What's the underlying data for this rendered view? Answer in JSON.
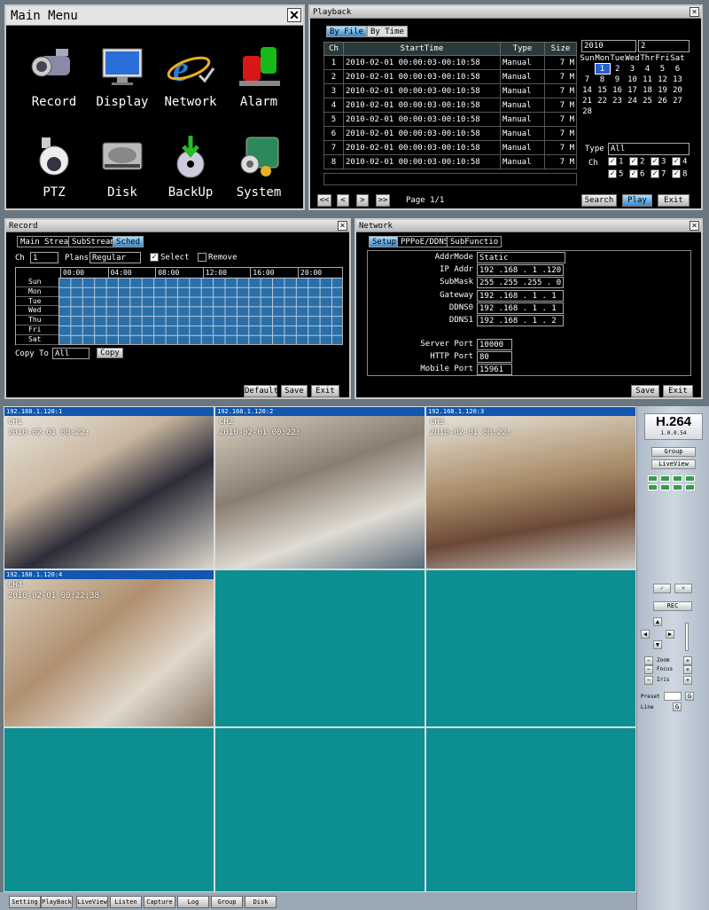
{
  "main_menu": {
    "title": "Main Menu",
    "items": [
      {
        "label": "Record",
        "icon": "camcorder-icon"
      },
      {
        "label": "Display",
        "icon": "monitor-icon"
      },
      {
        "label": "Network",
        "icon": "internet-explorer-icon"
      },
      {
        "label": "Alarm",
        "icon": "alarm-siren-icon"
      },
      {
        "label": "PTZ",
        "icon": "ptz-camera-icon"
      },
      {
        "label": "Disk",
        "icon": "hard-disk-icon"
      },
      {
        "label": "BackUp",
        "icon": "backup-disc-icon"
      },
      {
        "label": "System",
        "icon": "system-gear-icon"
      }
    ]
  },
  "playback": {
    "title": "Playback",
    "tabs": [
      "By File",
      "By Time"
    ],
    "columns": [
      "Ch",
      "StartTime",
      "Type",
      "Size"
    ],
    "rows": [
      {
        "ch": "1",
        "time": "2010-02-01 00:00:03-00:10:58",
        "type": "Manual",
        "size": "7 M"
      },
      {
        "ch": "2",
        "time": "2010-02-01 00:00:03-00:10:58",
        "type": "Manual",
        "size": "7 M"
      },
      {
        "ch": "3",
        "time": "2010-02-01 00:00:03-00:10:58",
        "type": "Manual",
        "size": "7 M"
      },
      {
        "ch": "4",
        "time": "2010-02-01 00:00:03-00:10:58",
        "type": "Manual",
        "size": "7 M"
      },
      {
        "ch": "5",
        "time": "2010-02-01 00:00:03-00:10:58",
        "type": "Manual",
        "size": "7 M"
      },
      {
        "ch": "6",
        "time": "2010-02-01 00:00:03-00:10:58",
        "type": "Manual",
        "size": "7 M"
      },
      {
        "ch": "7",
        "time": "2010-02-01 00:00:03-00:10:58",
        "type": "Manual",
        "size": "7 M"
      },
      {
        "ch": "8",
        "time": "2010-02-01 00:00:03-00:10:58",
        "type": "Manual",
        "size": "7 M"
      }
    ],
    "year": "2010",
    "month": "2",
    "weekdays": [
      "Sun",
      "Mon",
      "Tue",
      "Wed",
      "Thr",
      "Fri",
      "Sat"
    ],
    "days": [
      [
        "1",
        "2",
        "3",
        "4",
        "5",
        "6"
      ],
      [
        "7",
        "8",
        "9",
        "10",
        "11",
        "12",
        "13"
      ],
      [
        "14",
        "15",
        "16",
        "17",
        "18",
        "19",
        "20"
      ],
      [
        "21",
        "22",
        "23",
        "24",
        "25",
        "26",
        "27"
      ],
      [
        "28"
      ]
    ],
    "type_label": "Type",
    "type_value": "All",
    "ch_label": "Ch",
    "channels": [
      "1",
      "2",
      "3",
      "4",
      "5",
      "6",
      "7",
      "8"
    ],
    "nav": [
      "<<",
      "<",
      ">",
      ">>"
    ],
    "page": "Page 1/1",
    "buttons": {
      "search": "Search",
      "play": "Play",
      "exit": "Exit"
    }
  },
  "record": {
    "title": "Record",
    "tabs": [
      "Main Strea",
      "SubStream",
      "Sched"
    ],
    "ch_label": "Ch",
    "ch_value": "1",
    "plans_label": "Plans",
    "plans_value": "Regular",
    "select": "Select",
    "remove": "Remove",
    "hours": [
      "00:00",
      "04:00",
      "08:00",
      "12:00",
      "16:00",
      "20:00"
    ],
    "days": [
      "Sun",
      "Mon",
      "Tue",
      "Wed",
      "Thu",
      "Fri",
      "Sat"
    ],
    "copy_label": "Copy To",
    "copy_value": "All",
    "copy_btn": "Copy",
    "buttons": {
      "default": "Default",
      "save": "Save",
      "exit": "Exit"
    }
  },
  "network": {
    "title": "Network",
    "tabs": [
      "Setup",
      "PPPoE/DDNS",
      "SubFunctio"
    ],
    "fields": [
      {
        "label": "AddrMode",
        "value": "Static"
      },
      {
        "label": "IP Addr",
        "value": "192 .168 . 1 .120"
      },
      {
        "label": "SubMask",
        "value": "255 .255 .255 . 0"
      },
      {
        "label": "Gateway",
        "value": "192 .168 . 1 . 1"
      },
      {
        "label": "DDNS0",
        "value": "192 .168 . 1 . 1"
      },
      {
        "label": "DDNS1",
        "value": "192 .168 . 1 . 2"
      }
    ],
    "ports": [
      {
        "label": "Server Port",
        "value": "10000"
      },
      {
        "label": "HTTP Port",
        "value": "80"
      },
      {
        "label": "Mobile Port",
        "value": "15961"
      }
    ],
    "buttons": {
      "save": "Save",
      "exit": "Exit"
    }
  },
  "cameras": [
    {
      "ip": "192.168.1.120:1",
      "ch": "CH1",
      "ts": "2010-02-01 00:22:"
    },
    {
      "ip": "192.168.1.120:2",
      "ch": "CH2",
      "ts": "2010-02-01 00:22:"
    },
    {
      "ip": "192.168.1.120:3",
      "ch": "CH3",
      "ts": "2010-02-01 00:22:"
    },
    {
      "ip": "192.168.1.120:4",
      "ch": "CH4",
      "ts": "2010-02-01 00:22:38"
    }
  ],
  "sidebar": {
    "codec": "H.264",
    "version": "1.0.0.54",
    "group": "Group",
    "liveview": "LiveView",
    "rec": "REC",
    "zoom": "Zoom",
    "focus": "Focus",
    "iris": "Iris",
    "preset": "Preset",
    "line": "Line"
  },
  "bottom_tabs": [
    "Setting",
    "PlayBack",
    "LiveView",
    "Listen",
    "Capture",
    "Log",
    "Group",
    "Disk"
  ],
  "colors": {
    "video_bg": "#0d8f92",
    "cam_header": "#1256b0",
    "selected_tab": "#3a86c8"
  }
}
